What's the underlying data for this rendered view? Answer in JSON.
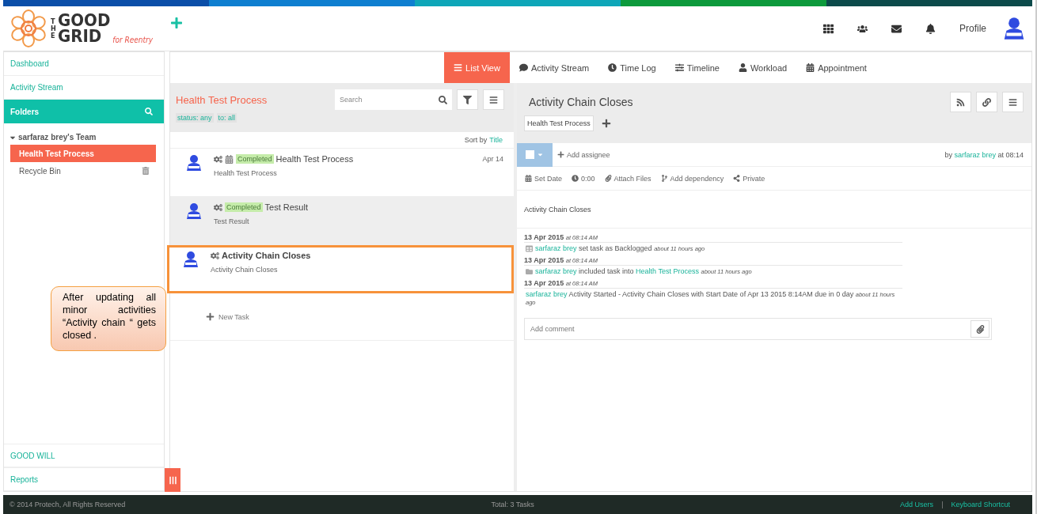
{
  "logo": {
    "the": "THE",
    "good": "GOOD",
    "grid": "GRID",
    "tagline": "for Reentry"
  },
  "header": {
    "profile": "Profile"
  },
  "sidebar": {
    "top_links": [
      {
        "label": "Dashboard"
      },
      {
        "label": "Activity Stream"
      }
    ],
    "folders": "Folders",
    "team": {
      "label": "sarfaraz brey's Team",
      "expanded": true,
      "children": [
        {
          "label": "Health Test Process",
          "selected": true,
          "trash": false
        },
        {
          "label": "Recycle Bin",
          "selected": false,
          "trash": true
        }
      ]
    },
    "bottom_links": [
      {
        "label": "GOOD WILL"
      },
      {
        "label": "Reports"
      }
    ]
  },
  "tabs": [
    {
      "label": "List View",
      "kind": "list",
      "selected": true
    },
    {
      "label": "Activity Stream",
      "kind": "comment",
      "selected": false
    },
    {
      "label": "Time Log",
      "kind": "clock",
      "selected": false
    },
    {
      "label": "Timeline",
      "kind": "sliders",
      "selected": false
    },
    {
      "label": "Workload",
      "kind": "user",
      "selected": false
    },
    {
      "label": "Appointment",
      "kind": "calendar",
      "selected": false
    }
  ],
  "list_panel": {
    "title": "Health Test Process",
    "search": {
      "placeholder": "Search"
    },
    "filters": [
      "status: any",
      "to: all"
    ],
    "sort": {
      "label": "Sort by",
      "value": "Title"
    },
    "tasks": [
      {
        "title": "Health Test Process",
        "subtitle": "Health Test Process",
        "status": "Completed",
        "calendar": true,
        "date": "Apr 14",
        "selected": false,
        "annotated": false
      },
      {
        "title": "Test Result",
        "subtitle": "Test Result",
        "status": "Completed",
        "calendar": false,
        "selected": true,
        "annotated": false
      },
      {
        "title": "Activity Chain Closes",
        "subtitle": "Activity Chain Closes",
        "calendar": false,
        "selected": false,
        "annotated": true
      }
    ],
    "new_task": "New Task"
  },
  "detail": {
    "title": "Activity Chain Closes",
    "tag": "Health Test Process",
    "add_assignee": "Add assignee",
    "checked": false,
    "by": {
      "prefix": "by",
      "user": "sarfaraz brey",
      "suffix": "at 08:14"
    },
    "actions": [
      {
        "label": "Set Date",
        "kind": "calendar"
      },
      {
        "label": "0:00",
        "kind": "clock"
      },
      {
        "label": "Attach Files",
        "kind": "clip"
      },
      {
        "label": "Add dependency",
        "kind": "branch"
      },
      {
        "label": "Private",
        "kind": "share"
      }
    ],
    "description": "Activity Chain Closes",
    "activity": [
      {
        "date": "13 Apr 2015",
        "time": "at 08:14 AM",
        "kind": "table",
        "user": "sarfaraz brey",
        "text": "set task as Backlogged",
        "ago": "about 11 hours ago"
      },
      {
        "date": "13 Apr 2015",
        "time": "at 08:14 AM",
        "kind": "folder",
        "user": "sarfaraz brey",
        "text": "included task into",
        "link": "Health Test Process",
        "ago": "about 11 hours ago"
      },
      {
        "date": "13 Apr 2015",
        "time": "at 08:14 AM",
        "user": "sarfaraz brey",
        "text": "Activity Started - Activity Chain Closes with Start Date of Apr 13 2015 8:14AM due in 0 day",
        "ago": "about 11 hours ago"
      }
    ],
    "comment": {
      "placeholder": "Add comment"
    }
  },
  "footer": {
    "copyright": "© 2014 Protech, All Rights Reserved",
    "total": "Total: 3 Tasks",
    "links": [
      "Add Users",
      "Keyboard Shortcut"
    ],
    "separator": "|"
  },
  "callout": "After updating all minor activities “Activity chain “ gets closed ."
}
